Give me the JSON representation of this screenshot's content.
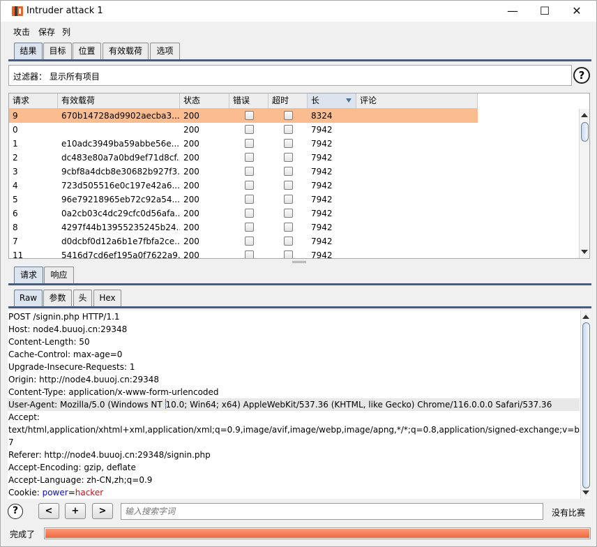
{
  "window": {
    "title": "Intruder attack 1",
    "minimize_glyph": "—",
    "maximize_glyph": "☐",
    "close_glyph": "✕"
  },
  "menu": [
    "攻击",
    "保存",
    "列"
  ],
  "main_tabs": [
    {
      "label": "结果",
      "active": true
    },
    {
      "label": "目标",
      "active": false
    },
    {
      "label": "位置",
      "active": false
    },
    {
      "label": "有效载荷",
      "active": false
    },
    {
      "label": "选项",
      "active": false
    }
  ],
  "filter": {
    "text": "过滤器：  显示所有项目"
  },
  "help_glyph": "?",
  "results_table": {
    "columns": [
      "请求",
      "有效载荷",
      "状态",
      "错误",
      "超时",
      "长",
      "评论"
    ],
    "sorted_column": "长",
    "selected_index": 0,
    "rows": [
      {
        "req": "9",
        "payload": "670b14728ad9902aecba3...",
        "status": "200",
        "len": "8324"
      },
      {
        "req": "0",
        "payload": "",
        "status": "200",
        "len": "7942"
      },
      {
        "req": "1",
        "payload": "e10adc3949ba59abbe56e...",
        "status": "200",
        "len": "7942"
      },
      {
        "req": "2",
        "payload": "dc483e80a7a0bd9ef71d8cf...",
        "status": "200",
        "len": "7942"
      },
      {
        "req": "3",
        "payload": "9cbf8a4dcb8e30682b927f3...",
        "status": "200",
        "len": "7942"
      },
      {
        "req": "4",
        "payload": "723d505516e0c197e42a6...",
        "status": "200",
        "len": "7942"
      },
      {
        "req": "5",
        "payload": "96e79218965eb72c92a54...",
        "status": "200",
        "len": "7942"
      },
      {
        "req": "6",
        "payload": "0a2cb03c4dc29cfc0d56afa...",
        "status": "200",
        "len": "7942"
      },
      {
        "req": "8",
        "payload": "4297f44b13955235245b24...",
        "status": "200",
        "len": "7942"
      },
      {
        "req": "7",
        "payload": "d0dcbf0d12a6b1e7fbfa2ce...",
        "status": "200",
        "len": "7942"
      },
      {
        "req": "11",
        "payload": "5416d7cd6ef195a0f7622a9...",
        "status": "200",
        "len": "7942"
      }
    ]
  },
  "detail_tabs": [
    {
      "label": "请求",
      "active": true
    },
    {
      "label": "响应",
      "active": false
    }
  ],
  "view_tabs": [
    {
      "label": "Raw",
      "active": true
    },
    {
      "label": "参数",
      "active": false
    },
    {
      "label": "头",
      "active": false
    },
    {
      "label": "Hex",
      "active": false
    }
  ],
  "request_lines": {
    "l0": "POST /signin.php HTTP/1.1",
    "l1": "Host: node4.buuoj.cn:29348",
    "l2": "Content-Length: 50",
    "l3": "Cache-Control: max-age=0",
    "l4": "Upgrade-Insecure-Requests: 1",
    "l5": "Origin: http://node4.buuoj.cn:29348",
    "l6": "Content-Type: application/x-www-form-urlencoded",
    "l7a": "User-Agent: Mozilla/5.0 (Windows NT ",
    "l7b": "10.0; Win64; x64) AppleWebKit/537.36 (KHTML, like Gecko) Chrome/116.0.0.0 Safari/537.36",
    "l8": "Accept:",
    "l9": "text/html,application/xhtml+xml,application/xml;q=0.9,image/avif,image/webp,image/apng,*/*;q=0.8,application/signed-exchange;v=b3;q=0.",
    "l10": "7",
    "l11": "Referer: http://node4.buuoj.cn:29348/signin.php",
    "l12": "Accept-Encoding: gzip, deflate",
    "l13": "Accept-Language: zh-CN,zh;q=0.9",
    "cookie_label": "Cookie: ",
    "cookie_key": "power",
    "cookie_eq": "=",
    "cookie_val": "hacker"
  },
  "search": {
    "prev_label": "<",
    "add_label": "+",
    "next_label": ">",
    "placeholder": "输入搜索字词",
    "match_text": "没有比赛"
  },
  "status": {
    "text": "完成了",
    "progress": 1.0
  },
  "colors": {
    "selected_row": "#fbbd8f",
    "progress": "#f0673d",
    "tab_accent": "#485d7d"
  }
}
